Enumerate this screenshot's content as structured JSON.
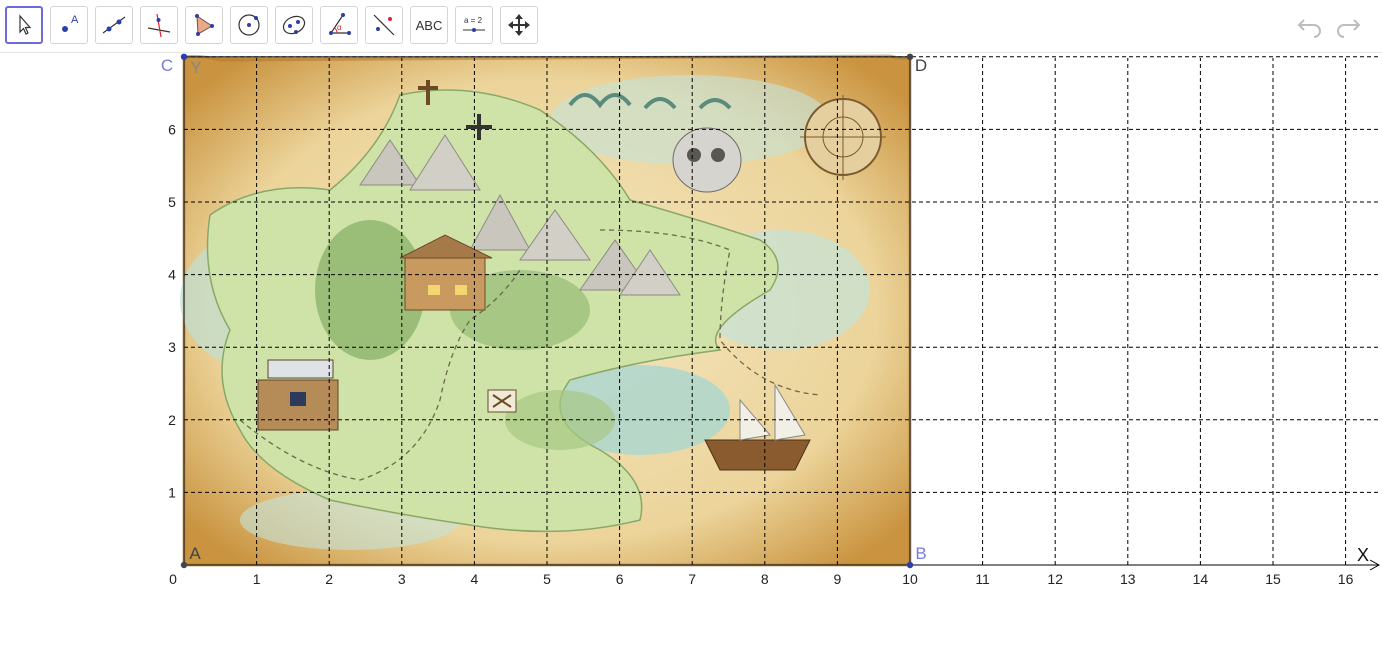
{
  "toolbar": {
    "tools": [
      {
        "name": "move-tool",
        "icon": "pointer-icon"
      },
      {
        "name": "point-tool",
        "icon": "point-icon",
        "label": "A"
      },
      {
        "name": "line-tool",
        "icon": "line-icon"
      },
      {
        "name": "perpendicular-line-tool",
        "icon": "perpendicular-icon"
      },
      {
        "name": "polygon-tool",
        "icon": "polygon-icon"
      },
      {
        "name": "circle-tool",
        "icon": "circle-icon"
      },
      {
        "name": "ellipse-tool",
        "icon": "ellipse-icon"
      },
      {
        "name": "angle-tool",
        "icon": "angle-icon",
        "label": "α"
      },
      {
        "name": "reflect-tool",
        "icon": "reflect-icon"
      },
      {
        "name": "text-tool",
        "icon": "text-icon",
        "label": "ABC"
      },
      {
        "name": "slider-tool",
        "icon": "slider-icon",
        "label": "a = 2"
      },
      {
        "name": "move-graphics-tool",
        "icon": "move-arrows-icon"
      }
    ],
    "undo_icon": "undo-icon",
    "redo_icon": "redo-icon"
  },
  "axes": {
    "x_label": "X",
    "y_label": "Y",
    "x_ticks": [
      "0",
      "1",
      "2",
      "3",
      "4",
      "5",
      "6",
      "7",
      "8",
      "9",
      "10",
      "11",
      "12",
      "13",
      "14",
      "15",
      "16"
    ],
    "y_ticks": [
      "1",
      "2",
      "3",
      "4",
      "5",
      "6"
    ]
  },
  "points": [
    {
      "label": "A",
      "x": 0,
      "y": 0
    },
    {
      "label": "B",
      "x": 10,
      "y": 0
    },
    {
      "label": "C",
      "x": 0,
      "y": 7
    },
    {
      "label": "D",
      "x": 10,
      "y": 7
    }
  ],
  "map_labels": {
    "title": "treasure-map-image"
  },
  "colors": {
    "accent": "#6b6bd9",
    "point_label_blue": "#7b7bdb",
    "grid": "#000000",
    "parchment": "#e9c98a"
  }
}
